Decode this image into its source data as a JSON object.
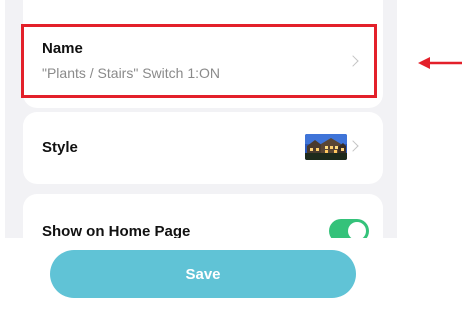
{
  "settings": {
    "name": {
      "label": "Name",
      "value": "\"Plants / Stairs\" Switch 1:ON",
      "icon": "chevron-right-icon"
    },
    "style": {
      "label": "Style",
      "thumbnail": "house-at-dusk-image",
      "icon": "chevron-right-icon"
    },
    "show_on_home": {
      "label": "Show on Home Page",
      "enabled": true
    }
  },
  "footer": {
    "save_label": "Save"
  },
  "colors": {
    "highlight": "#e3202a",
    "toggle_on": "#34c27a",
    "save_button": "#60c3d6",
    "annotation_arrow": "#e3202a"
  }
}
